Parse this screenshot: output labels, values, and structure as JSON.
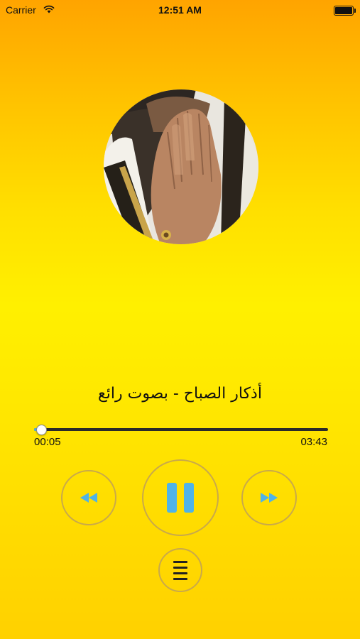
{
  "status_bar": {
    "carrier": "Carrier",
    "time": "12:51 AM",
    "icons": [
      "wifi-icon",
      "battery-icon"
    ]
  },
  "player": {
    "artwork": "praying-hands-photo",
    "track_title": "أذكار الصباح - بصوت رائع",
    "elapsed": "00:05",
    "duration": "03:43",
    "progress": 0.022
  },
  "controls": {
    "icons": [
      "rewind-icon",
      "pause-icon",
      "fast-forward-icon",
      "playlist-icon"
    ]
  },
  "colors": {
    "accent": "#4fb3e8",
    "button_border": "#c9a94a",
    "background_top": "#ffa400",
    "background_bottom": "#ffd100"
  }
}
